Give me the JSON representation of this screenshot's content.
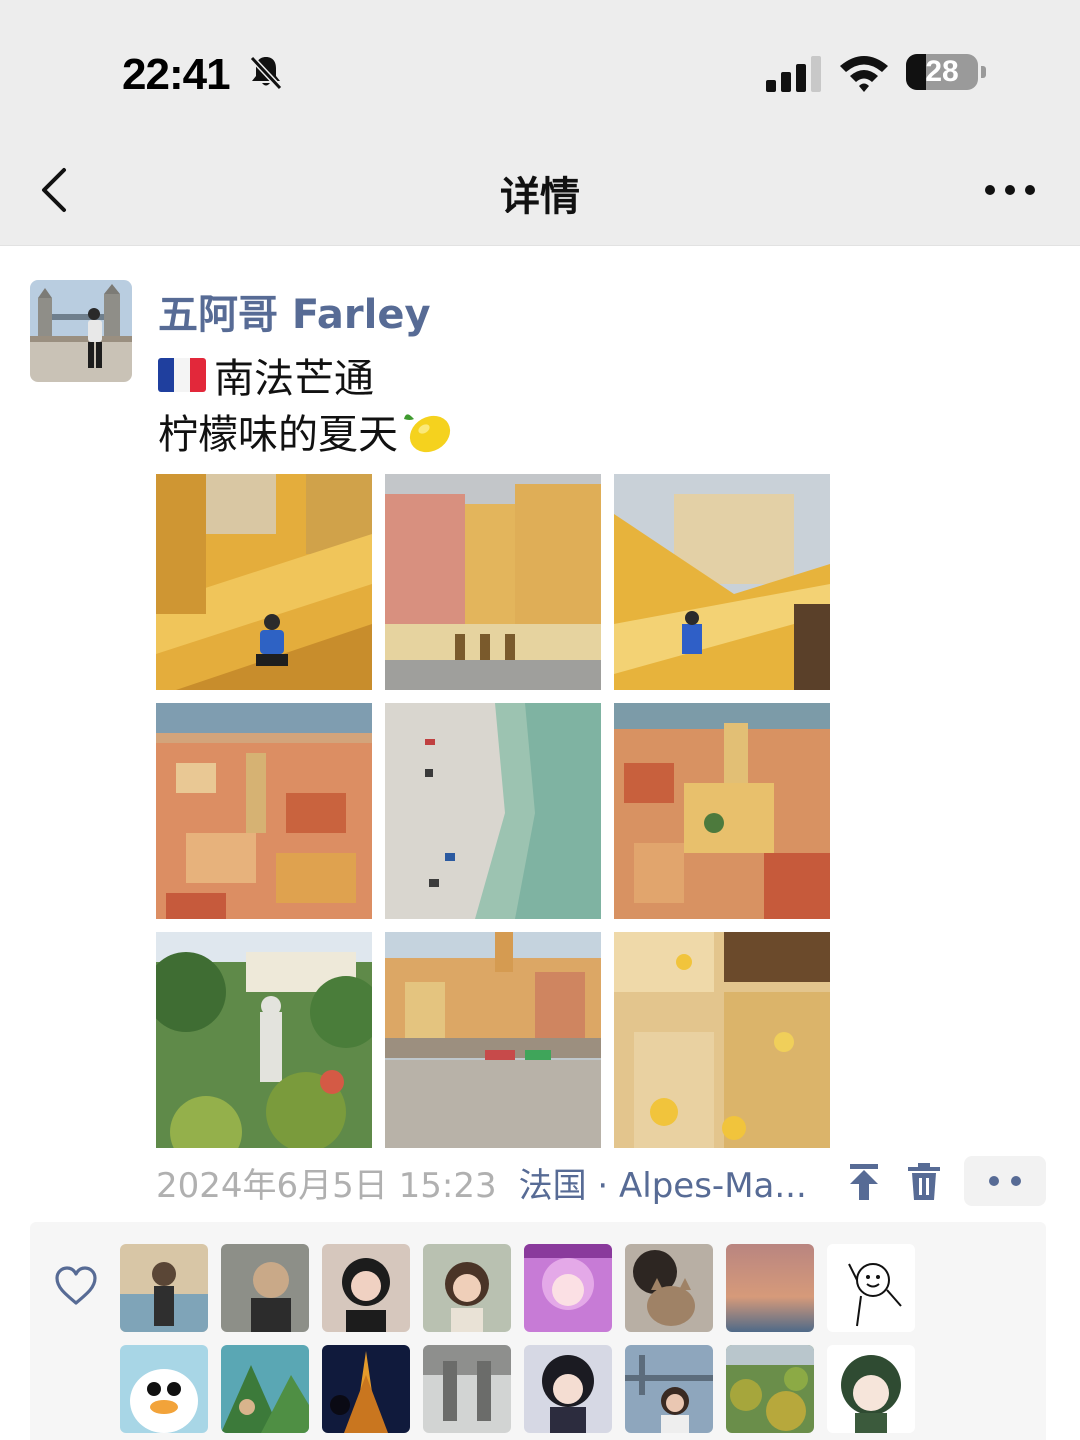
{
  "status_bar": {
    "time": "22:41",
    "battery": "28",
    "battery_level": 0.28,
    "icons": [
      "bell-slash-icon",
      "signal-icon",
      "wifi-icon",
      "battery-icon"
    ]
  },
  "nav": {
    "title": "详情",
    "back_icon": "chevron-left-icon",
    "more_icon": "more-horizontal-icon"
  },
  "post": {
    "author": "五阿哥 Farley",
    "line1_emoji": "flag-france",
    "line1": "南法芒通",
    "line2": "柠檬味的夏天",
    "line2_emoji": "lemon",
    "photo_count": 9,
    "date": "2024年6月5日 15:23",
    "location": "法国 · Alpes-Ma...",
    "action_icons": [
      "pin-top-icon",
      "trash-icon",
      "more-dots-icon"
    ]
  },
  "likes": {
    "icon": "heart-icon",
    "count_shown": 16
  },
  "colors": {
    "name_link": "#576b95",
    "meta_gray": "#b0b0b0",
    "header_bg": "#ededed",
    "likes_bg": "#f6f6f6"
  }
}
